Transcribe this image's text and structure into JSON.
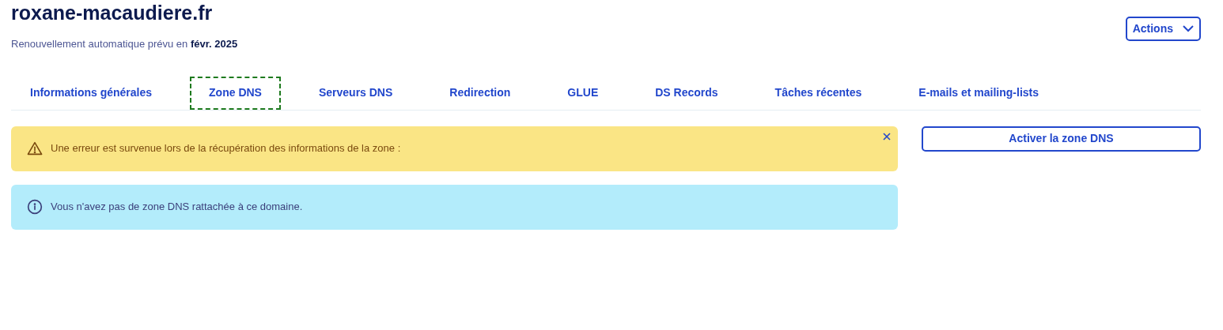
{
  "header": {
    "title": "roxane-macaudiere.fr",
    "subtitle": "Renouvellement automatique prévu en **févr. 2025**",
    "actions_button": "Actions"
  },
  "tabs": [
    {
      "label": "Informations générales",
      "selected": false
    },
    {
      "label": "Zone DNS",
      "selected": true
    },
    {
      "label": "Serveurs DNS",
      "selected": false
    },
    {
      "label": "Redirection",
      "selected": false
    },
    {
      "label": "GLUE",
      "selected": false
    },
    {
      "label": "DS Records",
      "selected": false
    },
    {
      "label": "Tâches récentes",
      "selected": false
    },
    {
      "label": "E-mails et mailing-lists",
      "selected": false
    }
  ],
  "alerts": [
    {
      "kind": "warning",
      "text": "Une erreur est survenue lors de la récupération des informations de la zone :",
      "dismissible": true
    },
    {
      "kind": "info",
      "text": "Vous n'avez pas de zone DNS rattachée à ce domaine.",
      "dismissible": false
    }
  ],
  "side_button": "Activer la zone DNS"
}
